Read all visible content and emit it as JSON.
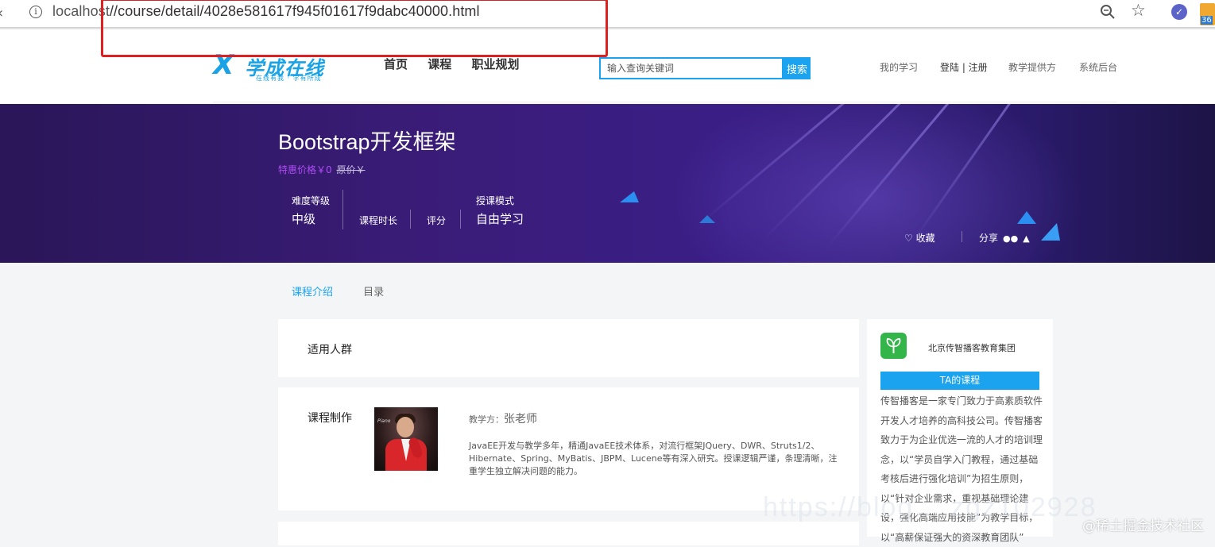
{
  "browser": {
    "url_host": "localhost",
    "url_path": "//course/detail/4028e581617f945f01617f9dabc40000.html",
    "extension_badge": "36"
  },
  "header": {
    "logo_name": "学成在线",
    "logo_slogan": "在线有我 · 学有所成",
    "nav": [
      "首页",
      "课程",
      "职业规划"
    ],
    "search_placeholder": "输入查询关键词",
    "search_button": "搜索",
    "my_learning": "我的学习",
    "login_register": "登陆 | 注册",
    "teaching_provider": "教学提供方",
    "system_admin": "系统后台"
  },
  "banner": {
    "title": "Bootstrap开发框架",
    "price_label": "特惠价格￥0",
    "original_price": "原价￥",
    "difficulty_label": "难度等级",
    "difficulty_value": "中级",
    "duration_label": "课程时长",
    "rating_label": "评分",
    "mode_label": "授课模式",
    "mode_value": "自由学习",
    "favorite": "收藏",
    "share": "分享"
  },
  "tabs": [
    "课程介绍",
    "目录"
  ],
  "intro": {
    "audience_title": "适用人群",
    "production_title": "课程制作",
    "teacher_prefix": "教学方：",
    "teacher_name": "张老师",
    "teacher_desc": "JavaEE开发与教学多年，精通JavaEE技术体系，对流行框架JQuery、DWR、Struts1/2、Hibernate、Spring、MyBatis、JBPM、Lucene等有深入研究。授课逻辑严谨，条理清晰，注重学生独立解决问题的能力。"
  },
  "org": {
    "name": "北京传智播客教育集团",
    "ta_courses": "TA的课程",
    "desc": "传智播客是一家专门致力于高素质软件开发人才培养的高科技公司。传智播客致力于为企业优选一流的人才的培训理念，以“学员自学入门教程，通过基础考核后进行强化培训”为招生原则，以“针对企业需求，重视基础理论建设，强化高端应用技能”为教学目标，以“高薪保证强大的资深教育团队”"
  },
  "watermark": "@稀土掘金技术社区",
  "colors": {
    "accent": "#1ba3ef",
    "price": "#b04cf5",
    "annotation": "#e02020"
  }
}
